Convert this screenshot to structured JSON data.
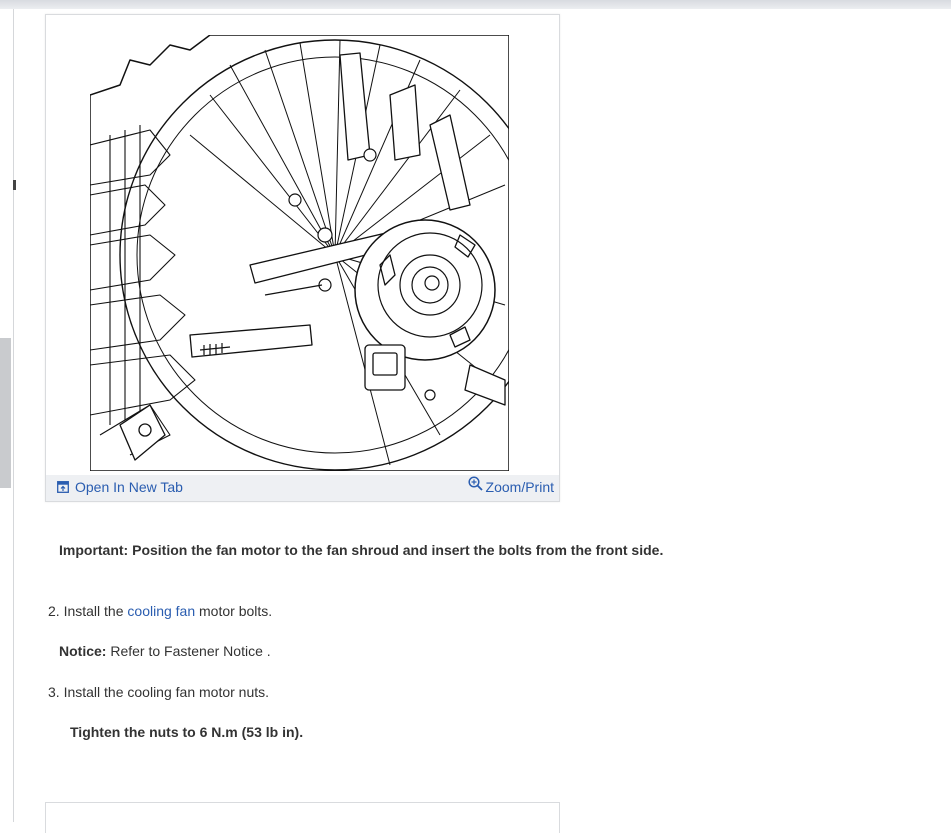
{
  "figure": {
    "open_new_tab": "Open In New Tab",
    "zoom_print": "Zoom/Print"
  },
  "important": {
    "label": "Important:",
    "text": "Position the fan motor to the fan shroud and insert the bolts from the front side."
  },
  "steps": [
    {
      "number": "2.",
      "pre": "Install the",
      "link": "cooling fan",
      "post": "motor bolts."
    },
    {
      "number": "3.",
      "text": "Install the cooling fan motor nuts."
    }
  ],
  "notice": {
    "label": "Notice:",
    "text": "Refer to Fastener Notice ."
  },
  "tighten": {
    "text": "Tighten the nuts to 6 N.m (53 lb in)."
  },
  "colors": {
    "link": "#2a5db0",
    "text": "#333333"
  }
}
